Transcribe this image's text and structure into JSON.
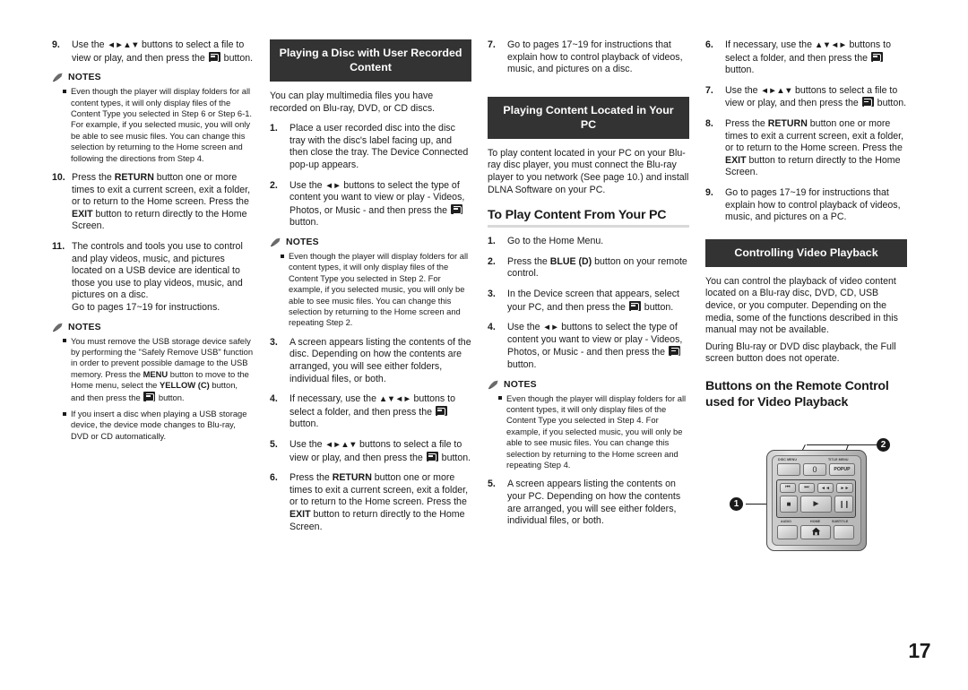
{
  "page": {
    "number": "17"
  },
  "notes_label": "NOTES",
  "col1": {
    "steps": [
      {
        "num": "9.",
        "parts": [
          {
            "t": "Use the "
          },
          {
            "arrows": "◄►▲▼"
          },
          {
            "t": " buttons to select a file to view or play, and then press the "
          },
          {
            "icon": "enter-button"
          },
          {
            "t": " button."
          }
        ]
      }
    ],
    "note1_items": [
      "Even though the player will display folders for all content types, it will only display files of the Content Type you selected in Step 6 or Step 6-1.",
      "For example, if you selected music, you will only be able to see music files. You can change this selection by returning to the Home screen and following the directions from Step 4."
    ],
    "steps2": [
      {
        "num": "10.",
        "text_a": "Press the ",
        "bold_a": "RETURN",
        "text_b": " button one or more times to exit a current screen, exit a folder, or to return to the Home screen. Press the ",
        "bold_b": "EXIT",
        "text_c": " button to return directly to the Home Screen."
      },
      {
        "num": "11.",
        "text": "The controls and tools you use to control and play videos, music, and pictures located on a USB device are identical to those you use to play videos, music, and pictures on a disc.",
        "text2": "Go to pages 17~19 for instructions."
      }
    ],
    "note2_items": [
      {
        "a": "You must remove the USB storage device safely by performing the \"Safely Remove USB\" function in order to prevent possible damage to the USB memory. Press the ",
        "b1": "MENU",
        "c": " button to move to the Home menu, select the ",
        "b2": "YELLOW (C)",
        "d": " button, and then press the ",
        "e": " button."
      },
      {
        "plain": "If you insert a disc when playing a USB storage device, the device mode changes to Blu-ray, DVD or CD automatically."
      }
    ]
  },
  "col2": {
    "banner": "Playing a Disc with User Recorded Content",
    "intro": "You can play multimedia files you have recorded on Blu-ray, DVD, or CD discs.",
    "step1_num": "1.",
    "step1": "Place a user recorded disc into the disc tray with the disc's label facing up, and then close the tray. The Device Connected pop-up appears.",
    "step2_num": "2.",
    "step2_a": "Use the ",
    "step2_arrows": "◄►",
    "step2_b": " buttons to select the type of content you want to view or play - Videos, Photos, or Music - and then press the ",
    "step2_c": " button.",
    "note_item": "Even though the player will display folders for all content types, it will only display files of the Content Type you selected in Step 2. For example, if you selected music, you will only be able to see music files. You can change this selection by returning to the Home screen and repeating Step 2.",
    "step3_num": "3.",
    "step3": "A screen appears listing the contents of the disc. Depending on how the contents are arranged, you will see either folders, individual files, or both.",
    "step4_num": "4.",
    "step4_a": "If necessary, use the ",
    "step4_arrows": "▲▼◄►",
    "step4_b": " buttons to select a folder, and then press the ",
    "step4_c": " button.",
    "step5_num": "5.",
    "step5_a": "Use the ",
    "step5_arrows": "◄►▲▼",
    "step5_b": " buttons to select a file to view or play, and then press the ",
    "step5_c": " button.",
    "step6_num": "6.",
    "step6_a": "Press the ",
    "step6_b1": "RETURN",
    "step6_b": " button one or more times to exit a current screen, exit a folder, or to return to the Home screen. Press the ",
    "step6_b2": "EXIT",
    "step6_c": " button to return directly to the Home Screen."
  },
  "col3": {
    "step7_num": "7.",
    "step7": "Go to pages 17~19 for instructions that explain how to control playback of videos, music, and pictures on a disc.",
    "banner": "Playing Content Located in Your PC",
    "intro": "To play content located in your PC on your Blu-ray disc player, you must connect the Blu-ray player to you network (See page 10.) and install DLNA Software on your PC.",
    "subhead": "To Play Content From Your PC",
    "step1_num": "1.",
    "step1": "Go to the Home Menu.",
    "step2_num": "2.",
    "step2_a": "Press the ",
    "step2_b": "BLUE (D)",
    "step2_c": " button on your remote control.",
    "step3_num": "3.",
    "step3_a": "In the Device screen that appears, select your PC, and then press the ",
    "step3_c": " button.",
    "step4_num": "4.",
    "step4_a": "Use the ",
    "step4_arrows": "◄►",
    "step4_b": " buttons to select the type of content you want to view or play - Videos, Photos, or Music - and then press the ",
    "step4_c": " button.",
    "note_item": "Even though the player will display folders for all content types, it will only display files of the Content Type you selected in Step 4. For example, if you selected music, you will only be able to see music files. You can change this selection by returning to the Home screen and repeating Step 4.",
    "step5_num": "5.",
    "step5": "A screen appears listing the contents on your PC. Depending on how the contents are arranged, you will see either folders, individual files, or both."
  },
  "col4": {
    "step6_num": "6.",
    "step6_a": "If necessary, use the ",
    "step6_arrows": "▲▼◄►",
    "step6_b": " buttons to select a folder, and then press the ",
    "step6_c": " button.",
    "step7_num": "7.",
    "step7_a": "Use the ",
    "step7_arrows": "◄►▲▼",
    "step7_b": " buttons to select a file to view or play, and then press the ",
    "step7_c": " button.",
    "step8_num": "8.",
    "step8_a": "Press the ",
    "step8_b1": "RETURN",
    "step8_b": " button one or more times to exit a current screen, exit a folder, or to return to the Home screen. Press the ",
    "step8_b2": "EXIT",
    "step8_c": " button to return directly to the Home Screen.",
    "step9_num": "9.",
    "step9": "Go to pages 17~19 for instructions that explain how to control playback of videos, music, and pictures on a PC.",
    "banner": "Controlling Video Playback",
    "intro1": "You can control the playback of video content located on a Blu-ray disc, DVD, CD, USB device, or you computer. Depending on the media, some of the functions described in this manual may not be available.",
    "intro2": "During Blu-ray or DVD disc playback, the Full screen button does not operate.",
    "bighead": "Buttons on the Remote Control used for Video Playback"
  },
  "remote": {
    "labels": {
      "disc_menu": "DISC MENU",
      "title_menu": "TITLE MENU",
      "audio": "AUDIO",
      "home": "HOME",
      "subtitle": "SUBTITLE"
    },
    "keys": {
      "zero": "0",
      "popup": "POPUP",
      "prev": "⏮",
      "next": "⏭",
      "rew": "◄◄",
      "ff": "►►",
      "stop": "■",
      "play": "►",
      "pause": "❙❙",
      "home_glyph": "home-icon"
    },
    "callouts": {
      "one": "1",
      "two": "2"
    }
  },
  "colors": {
    "banner_bg": "#333333",
    "rule": "#d9d9d9",
    "text": "#1a1a1a"
  }
}
